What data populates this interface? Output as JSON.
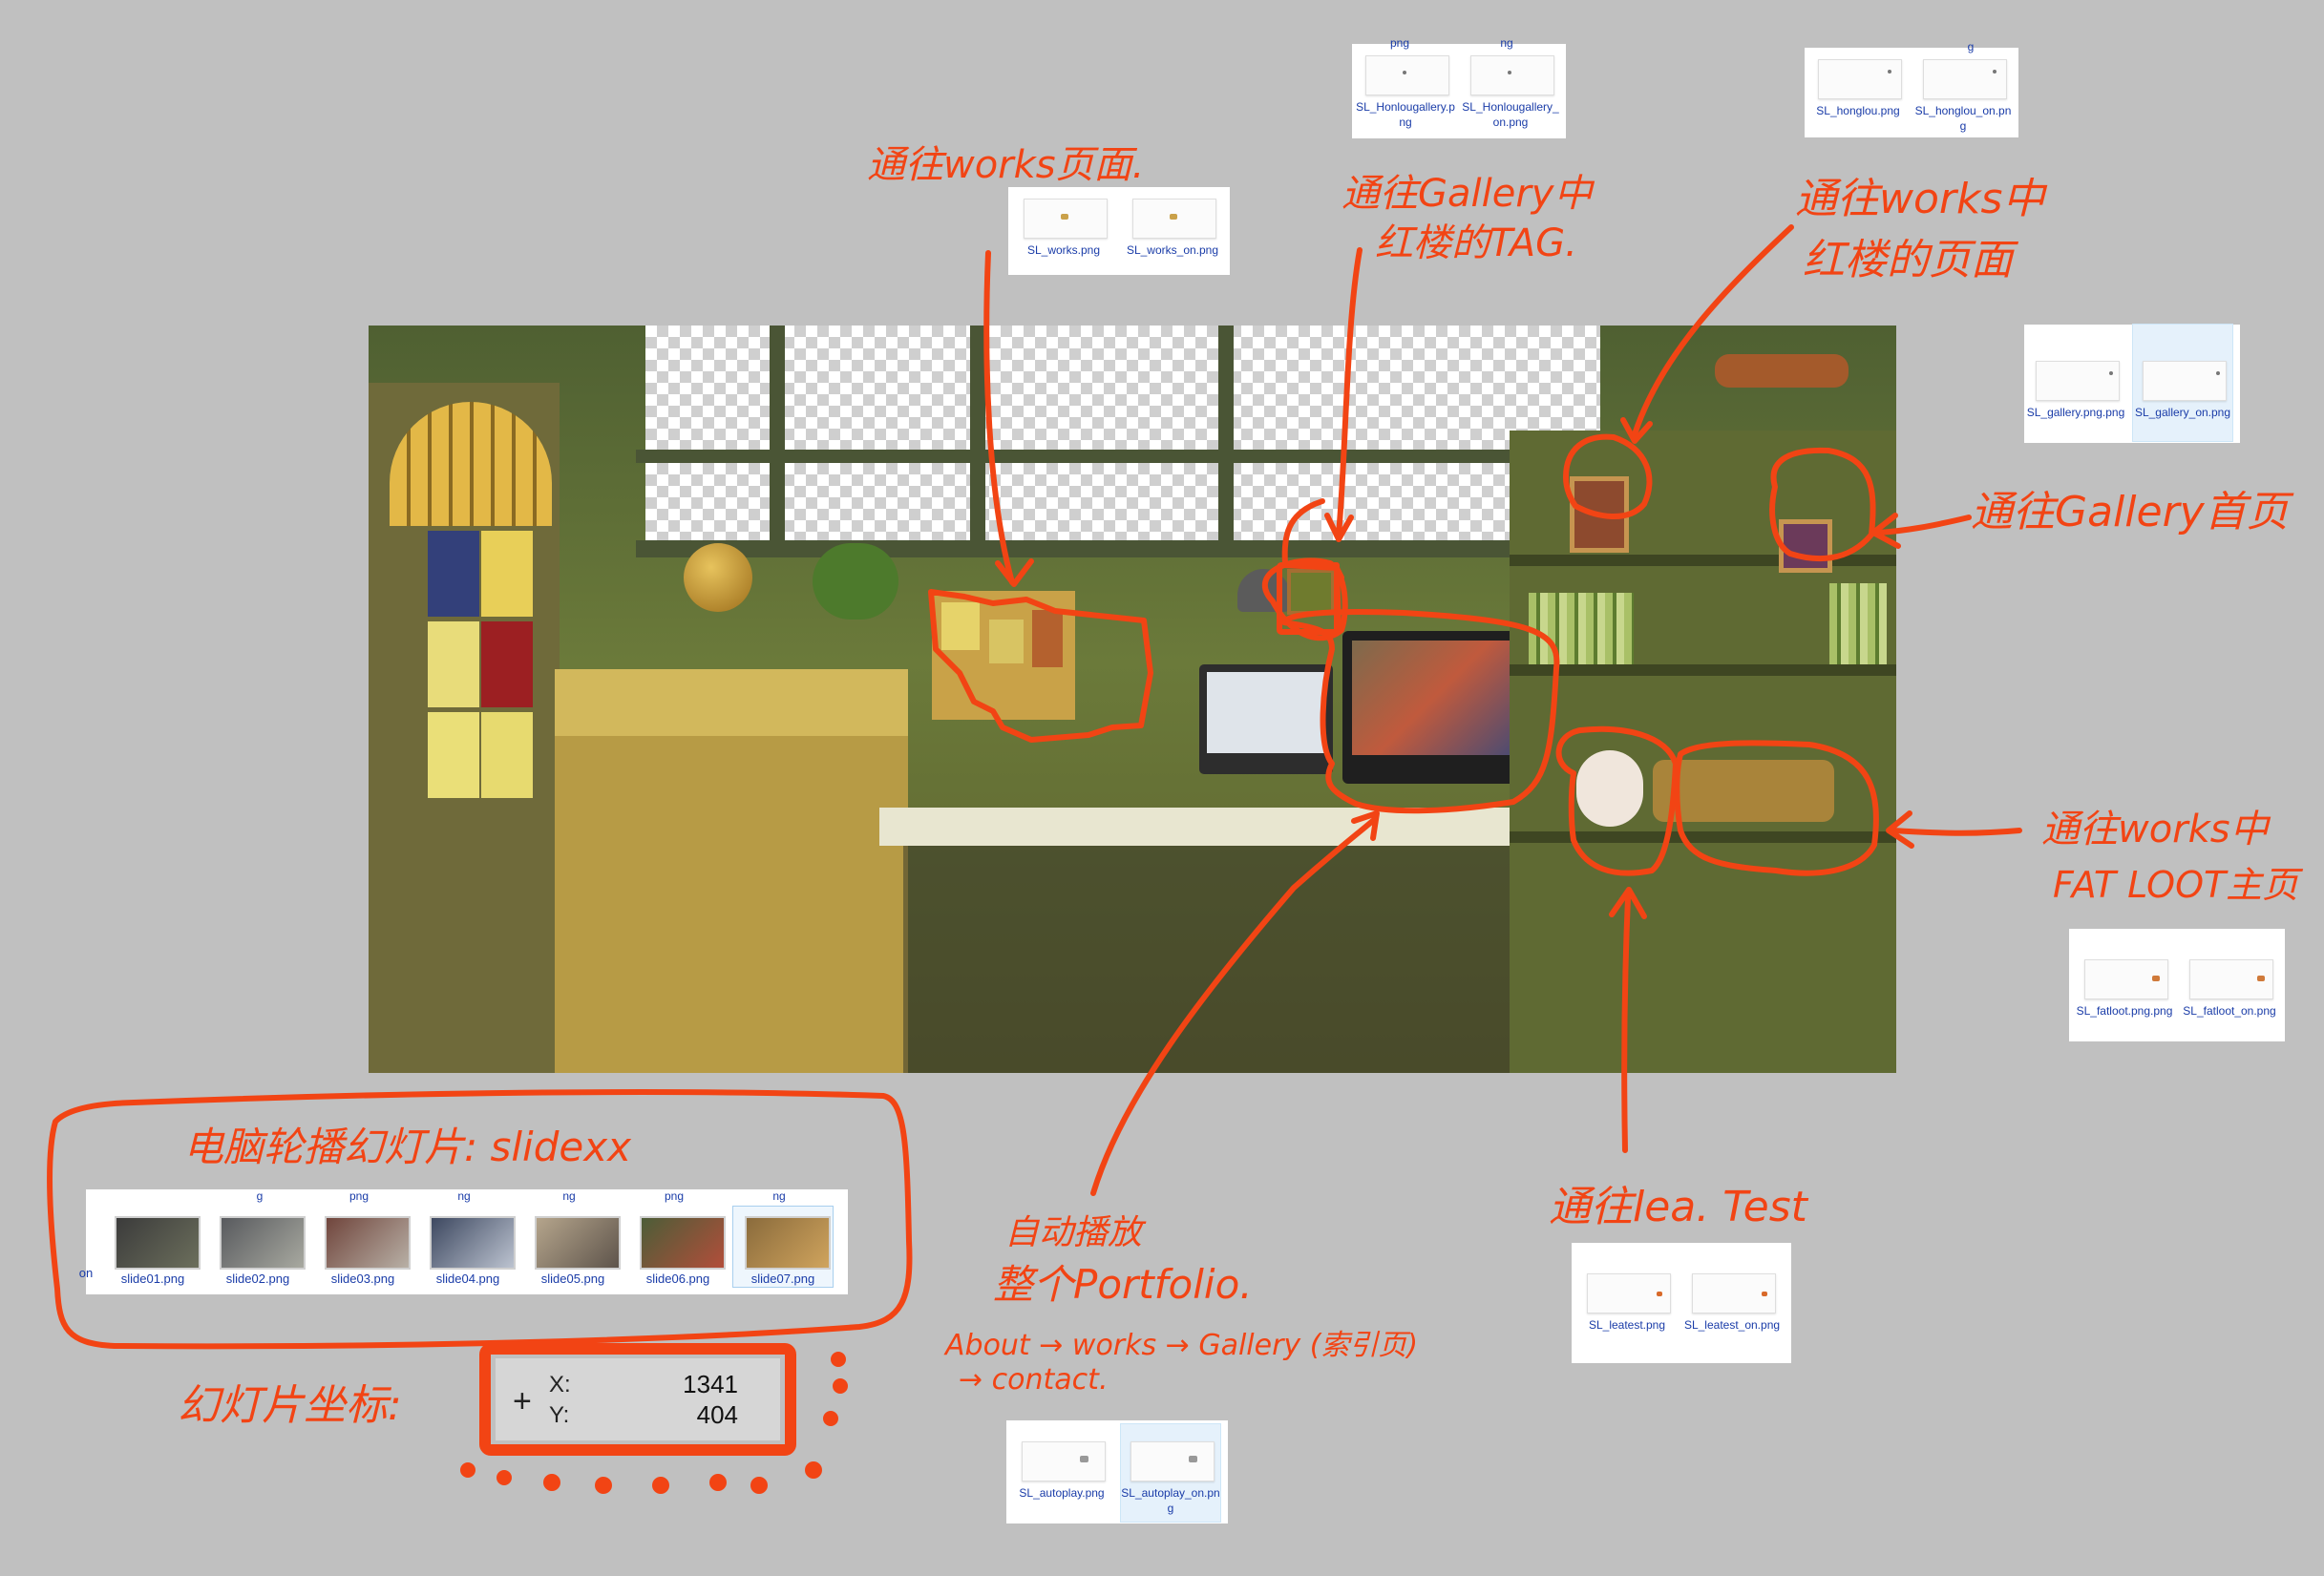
{
  "annotations": {
    "works_page": "通往works页面.",
    "gallery_tag": [
      "通往Gallery中",
      "红楼的TAG."
    ],
    "works_honglou": [
      "通往works中",
      "红楼的页面"
    ],
    "gallery_home": "通往Gallery首页",
    "fatloot": [
      "通往works中",
      "FAT LOOT主页"
    ],
    "leatest": "通往lea. Test",
    "autoplay": [
      "自动播放",
      "整个Portfolio."
    ],
    "autoplay_order": [
      "About → works → Gallery (索引页)",
      "→ contact."
    ],
    "slideshow": "电脑轮播幻灯片: slidexx",
    "slide_coords": "幻灯片坐标:"
  },
  "files": {
    "works": [
      {
        "name": "SL_works.png"
      },
      {
        "name": "SL_works_on.png"
      }
    ],
    "honlougallery": [
      {
        "name": "SL_Honlougallery.png"
      },
      {
        "name": "SL_Honlougallery_on.png"
      }
    ],
    "honlougallery_cut": [
      "png",
      "ng"
    ],
    "honglou": [
      {
        "name": "SL_honglou.png"
      },
      {
        "name": "SL_honglou_on.png"
      }
    ],
    "honglou_cut": [
      "g"
    ],
    "gallery": [
      {
        "name": "SL_gallery.png.png"
      },
      {
        "name": "SL_gallery_on.png"
      }
    ],
    "fatloot": [
      {
        "name": "SL_fatloot.png.png"
      },
      {
        "name": "SL_fatloot_on.png"
      }
    ],
    "leatest": [
      {
        "name": "SL_leatest.png"
      },
      {
        "name": "SL_leatest_on.png"
      }
    ],
    "autoplay": [
      {
        "name": "SL_autoplay.png"
      },
      {
        "name": "SL_autoplay_on.png"
      }
    ]
  },
  "slides": {
    "cut_left": "on",
    "items": [
      "slide01.png",
      "slide02.png",
      "slide03.png",
      "slide04.png",
      "slide05.png",
      "slide06.png",
      "slide07.png"
    ],
    "cut_top": [
      "g",
      "png",
      "ng",
      "ng",
      "png",
      "ng"
    ]
  },
  "coordinates": {
    "x_label": "X:",
    "y_label": "Y:",
    "x": "1341",
    "y": "404"
  },
  "colors": {
    "annotation": "#f24414",
    "canvas": "#c0c0c0",
    "file_label": "#1a3ca8"
  }
}
